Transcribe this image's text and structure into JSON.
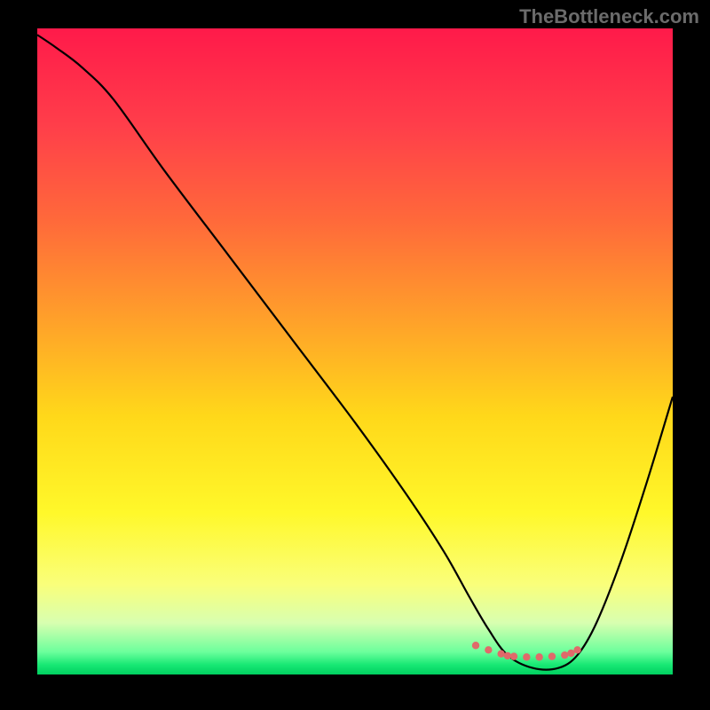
{
  "watermark": "TheBottleneck.com",
  "chart_data": {
    "type": "line",
    "title": "",
    "xlabel": "",
    "ylabel": "",
    "xlim": [
      0,
      100
    ],
    "ylim": [
      0,
      100
    ],
    "grid": false,
    "legend": false,
    "background": {
      "type": "vertical-gradient",
      "stops": [
        {
          "offset": 0.0,
          "color": "#ff1a4a"
        },
        {
          "offset": 0.15,
          "color": "#ff3e4a"
        },
        {
          "offset": 0.3,
          "color": "#ff6a3a"
        },
        {
          "offset": 0.45,
          "color": "#ffa02a"
        },
        {
          "offset": 0.6,
          "color": "#ffd81a"
        },
        {
          "offset": 0.75,
          "color": "#fff82a"
        },
        {
          "offset": 0.86,
          "color": "#faff7a"
        },
        {
          "offset": 0.92,
          "color": "#d8ffb0"
        },
        {
          "offset": 0.965,
          "color": "#6cff9c"
        },
        {
          "offset": 0.985,
          "color": "#18e874"
        },
        {
          "offset": 1.0,
          "color": "#00d060"
        }
      ]
    },
    "series": [
      {
        "name": "bottleneck-curve",
        "color": "#000000",
        "x": [
          0,
          3,
          7,
          12,
          20,
          30,
          40,
          50,
          58,
          64,
          68,
          71,
          74,
          78,
          82,
          85,
          88,
          92,
          96,
          100
        ],
        "values": [
          99,
          97,
          94,
          89,
          78,
          65,
          52,
          39,
          28,
          19,
          12,
          7,
          3,
          1,
          1,
          3,
          8,
          18,
          30,
          43
        ]
      },
      {
        "name": "optimal-range-markers",
        "color": "#e06a6a",
        "type": "scatter",
        "x": [
          69,
          71,
          73,
          74,
          75,
          77,
          79,
          81,
          83,
          84,
          85
        ],
        "values": [
          4.5,
          3.8,
          3.2,
          2.9,
          2.8,
          2.7,
          2.7,
          2.8,
          3.0,
          3.3,
          3.8
        ]
      }
    ]
  }
}
